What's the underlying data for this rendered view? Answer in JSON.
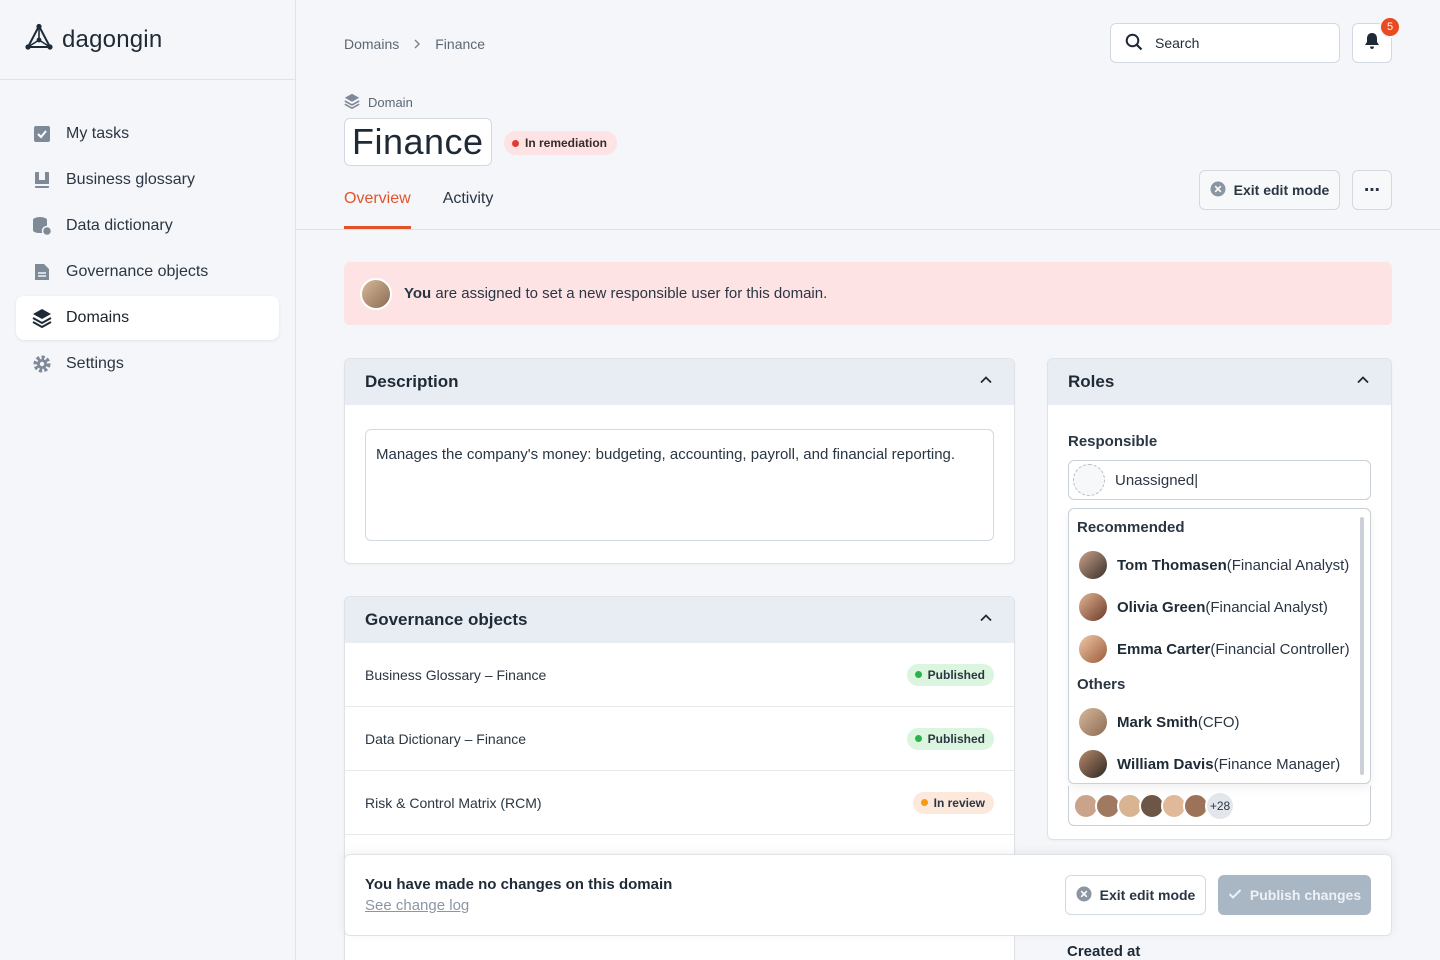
{
  "app": {
    "name": "dagongin"
  },
  "sidebar": {
    "items": [
      {
        "label": "My tasks",
        "icon": "checkbox-icon",
        "active": false
      },
      {
        "label": "Business glossary",
        "icon": "book-icon",
        "active": false
      },
      {
        "label": "Data dictionary",
        "icon": "database-icon",
        "active": false
      },
      {
        "label": "Governance objects",
        "icon": "document-icon",
        "active": false
      },
      {
        "label": "Domains",
        "icon": "layers-icon",
        "active": true
      },
      {
        "label": "Settings",
        "icon": "gear-icon",
        "active": false
      }
    ]
  },
  "breadcrumb": [
    "Domains",
    "Finance"
  ],
  "search": {
    "placeholder": "Search"
  },
  "notifications": {
    "count": "5"
  },
  "entity": {
    "type": "Domain",
    "title": "Finance",
    "status": "In remediation"
  },
  "tabs": [
    {
      "label": "Overview",
      "active": true
    },
    {
      "label": "Activity",
      "active": false
    }
  ],
  "actions": {
    "exit_edit": "Exit edit mode",
    "more": "⋯"
  },
  "alert": {
    "bold": "You",
    "text": " are assigned to set a new responsible user for this domain."
  },
  "description": {
    "heading": "Description",
    "text": "Manages the company's money: budgeting, accounting, payroll, and financial reporting."
  },
  "governance": {
    "heading": "Governance objects",
    "rows": [
      {
        "name": "Business Glossary – Finance",
        "status": "Published",
        "kind": "published"
      },
      {
        "name": "Data Dictionary – Finance",
        "status": "Published",
        "kind": "published"
      },
      {
        "name": "Risk & Control Matrix (RCM)",
        "status": "In review",
        "kind": "review"
      }
    ]
  },
  "roles": {
    "heading": "Roles",
    "responsible_label": "Responsible",
    "responsible_value": "Unassigned|",
    "recommended_label": "Recommended",
    "recommended": [
      {
        "name": "Tom Thomasen",
        "role": "(Financial Analyst)"
      },
      {
        "name": "Olivia Green",
        "role": "(Financial Analyst)"
      },
      {
        "name": "Emma Carter",
        "role": "(Financial Controller)"
      }
    ],
    "others_label": "Others",
    "others": [
      {
        "name": "Mark Smith",
        "role": "(CFO)"
      },
      {
        "name": "William Davis",
        "role": "(Finance Manager)"
      }
    ],
    "more_count": "+28"
  },
  "savebar": {
    "message": "You have made no changes on this domain",
    "link": "See change log",
    "exit": "Exit edit mode",
    "publish": "Publish changes"
  },
  "created_at_label": "Created at",
  "colors": {
    "accent": "#e2532b",
    "alert_bg": "#fde3e3",
    "published": "#2bb24c",
    "review": "#f59a14",
    "remediation": "#e53935"
  }
}
